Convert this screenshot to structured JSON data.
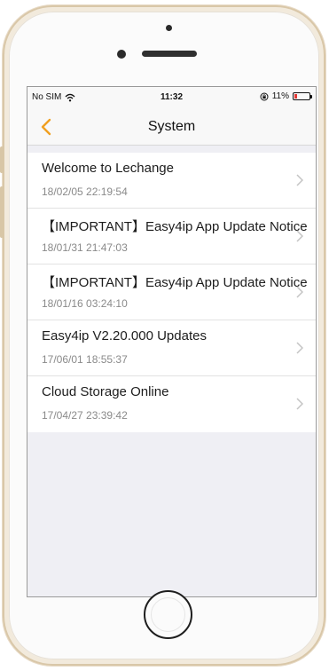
{
  "status_bar": {
    "carrier": "No SIM",
    "time": "11:32",
    "battery": "11%"
  },
  "nav": {
    "title": "System"
  },
  "messages": [
    {
      "title": "Welcome to Lechange",
      "time": "18/02/05 22:19:54"
    },
    {
      "title": "【IMPORTANT】Easy4ip App Update Notice",
      "time": "18/01/31 21:47:03"
    },
    {
      "title": "【IMPORTANT】Easy4ip App Update Notice",
      "time": "18/01/16 03:24:10"
    },
    {
      "title": "Easy4ip V2.20.000 Updates",
      "time": "17/06/01 18:55:37"
    },
    {
      "title": "Cloud Storage Online",
      "time": "17/04/27 23:39:42"
    }
  ],
  "colors": {
    "accent": "#f0a020",
    "battery_low": "#e53935",
    "background": "#efeff4"
  }
}
